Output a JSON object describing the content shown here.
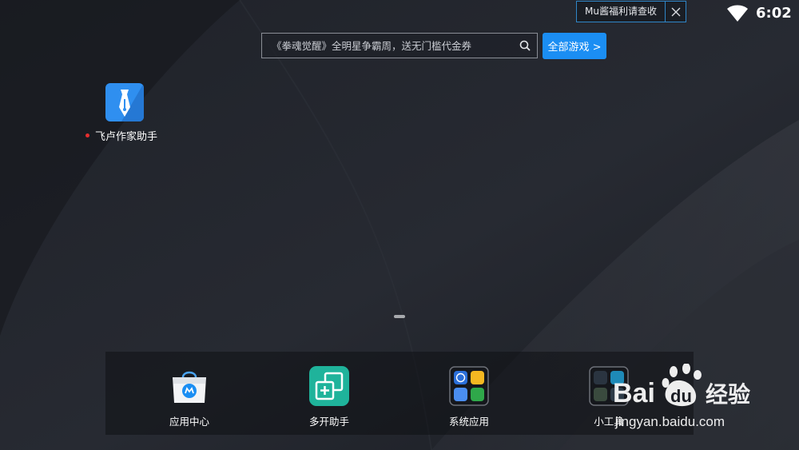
{
  "status_bar": {
    "notification_text": "Mu酱福利请查收",
    "time": "6:02"
  },
  "search": {
    "placeholder": "《拳魂觉醒》全明星争霸周，送无门槛代金券",
    "all_games_label": "全部游戏 >"
  },
  "desktop_apps": [
    {
      "label": "飞卢作家助手",
      "icon": "pen-nib-icon",
      "has_new_badge": true
    }
  ],
  "dock": [
    {
      "label": "应用中心",
      "icon": "app-center-bag-icon"
    },
    {
      "label": "多开助手",
      "icon": "multi-instance-icon"
    },
    {
      "label": "系统应用",
      "icon": "system-apps-folder-icon"
    },
    {
      "label": "小工具",
      "icon": "tools-folder-icon"
    }
  ],
  "watermark": {
    "logo_text": "Bai du 经验",
    "url": "jingyan.baidu.com"
  },
  "colors": {
    "accent": "#1b8ef3",
    "notification_border": "#2f86c8",
    "badge_red": "#e62e2e"
  }
}
